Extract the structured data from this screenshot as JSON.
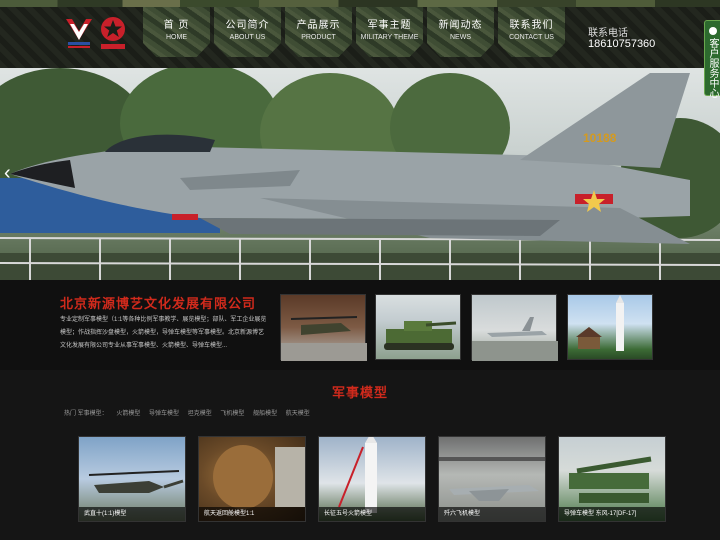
{
  "header": {
    "nav": [
      {
        "cn": "首 页",
        "en": "HOME"
      },
      {
        "cn": "公司简介",
        "en": "ABOUT US"
      },
      {
        "cn": "产品展示",
        "en": "PRODUCT"
      },
      {
        "cn": "军事主题",
        "en": "MILITARY THEME"
      },
      {
        "cn": "新闻动态",
        "en": "NEWS"
      },
      {
        "cn": "联系我们",
        "en": "CONTACT US"
      }
    ],
    "contact_label": "联系电话",
    "contact_phone": "18610757360"
  },
  "side_tab": {
    "label": "客户服务中心"
  },
  "banner": {
    "plane_marking": "10188"
  },
  "about": {
    "title": "北京新源博艺文化发展有限公司",
    "text": "专业定制军事模型（1:1等各种比例军事教学、展览模型；部队、军工企业展览模型；作战指挥沙盘模型，火箭模型，导弹车模型等军事模型。北京新源博艺文化发展有限公司专业从事军事模型、火箭模型、导弹车模型..."
  },
  "military": {
    "title": "军事模型",
    "hot_tags": [
      "热门 军事模型：",
      "火箭模型",
      "导弹车模型",
      "坦克模型",
      "飞机模型",
      "舰船模型",
      "航天模型"
    ],
    "items": [
      {
        "caption": "武直十(1:1)模型"
      },
      {
        "caption": "航天返回舱模型1:1"
      },
      {
        "caption": "长征五号火箭模型"
      },
      {
        "caption": "歼六飞机模型"
      },
      {
        "caption": "导弹车模型 东风-17[DF-17]"
      }
    ]
  },
  "colors": {
    "accent_red": "#d02a1c",
    "nav_green": "#3f4d34",
    "side_tab_green": "#2d6a2e"
  }
}
